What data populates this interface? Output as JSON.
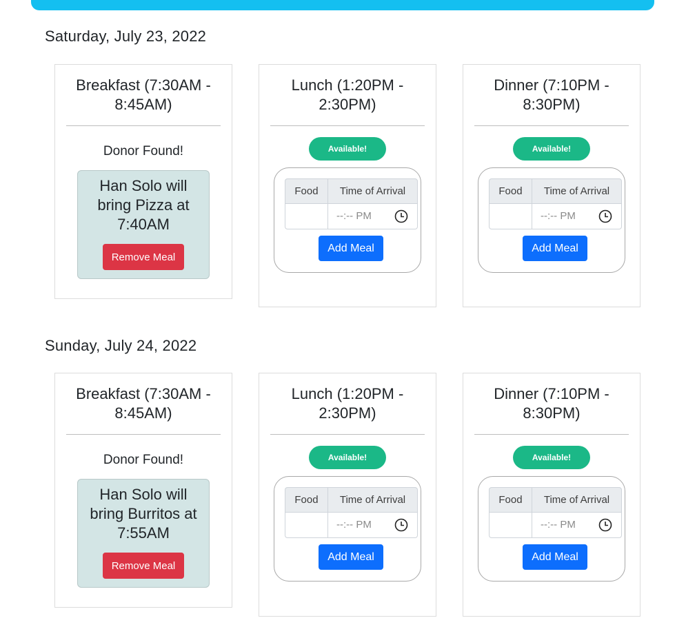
{
  "days": [
    {
      "date": "Saturday, July 23, 2022",
      "meals": [
        {
          "title": "Breakfast (7:30AM - 8:45AM)",
          "donor_heading": "Donor Found!",
          "donor_text": "Han Solo will bring Pizza at 7:40AM",
          "remove_label": "Remove Meal"
        },
        {
          "title": "Lunch (1:20PM - 2:30PM)",
          "badge": "Available!",
          "food_header": "Food",
          "time_header": "Time of Arrival",
          "food_value": "",
          "time_value": "--:-- PM",
          "add_label": "Add Meal"
        },
        {
          "title": "Dinner (7:10PM - 8:30PM)",
          "badge": "Available!",
          "food_header": "Food",
          "time_header": "Time of Arrival",
          "food_value": "",
          "time_value": "--:-- PM",
          "add_label": "Add Meal"
        }
      ]
    },
    {
      "date": "Sunday, July 24, 2022",
      "meals": [
        {
          "title": "Breakfast (7:30AM - 8:45AM)",
          "donor_heading": "Donor Found!",
          "donor_text": "Han Solo will bring Burritos at 7:55AM",
          "remove_label": "Remove Meal"
        },
        {
          "title": "Lunch (1:20PM - 2:30PM)",
          "badge": "Available!",
          "food_header": "Food",
          "time_header": "Time of Arrival",
          "food_value": "",
          "time_value": "--:-- PM",
          "add_label": "Add Meal"
        },
        {
          "title": "Dinner (7:10PM - 8:30PM)",
          "badge": "Available!",
          "food_header": "Food",
          "time_header": "Time of Arrival",
          "food_value": "",
          "time_value": "--:-- PM",
          "add_label": "Add Meal"
        }
      ]
    }
  ],
  "colors": {
    "header_bar": "#14bff0",
    "available_badge": "#1bb887",
    "remove_button": "#dc3545",
    "add_button": "#0d6efd",
    "donor_box": "#d3e5e5"
  },
  "icons": {
    "time_picker": "clock-icon"
  }
}
